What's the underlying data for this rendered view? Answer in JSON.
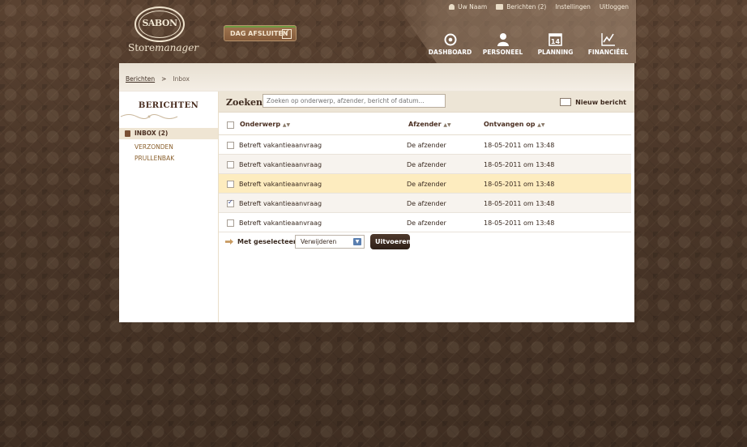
{
  "brand": {
    "logo_text": "SABON",
    "store": "Store",
    "manager": "manager"
  },
  "day_close": {
    "label": "DAG AFSLUITEN"
  },
  "topbar": {
    "user": "Uw Naam",
    "messages": "Berichten (2)",
    "settings": "Instellingen",
    "logout": "Uitloggen"
  },
  "nav": [
    {
      "label": "DASHBOARD",
      "icon": "target-icon"
    },
    {
      "label": "PERSONEEL",
      "icon": "user-icon"
    },
    {
      "label": "PLANNING",
      "icon": "calendar-icon",
      "day": "14"
    },
    {
      "label": "FINANCIËEL",
      "icon": "chart-icon"
    }
  ],
  "breadcrumb": {
    "root": "Berichten",
    "sep": ">",
    "current": "Inbox"
  },
  "sidebar": {
    "title": "BERICHTEN",
    "items": [
      {
        "label": "INBOX (2)"
      },
      {
        "label": "VERZONDEN"
      },
      {
        "label": "PRULLENBAK"
      }
    ]
  },
  "search": {
    "label": "Zoeken:",
    "placeholder": "Zoeken op onderwerp, afzender, bericht of datum..."
  },
  "new_message": {
    "label": "Nieuw bericht"
  },
  "table": {
    "headers": [
      "Onderwerp",
      "Afzender",
      "Ontvangen op"
    ],
    "sort_glyph": "▲▼",
    "rows": [
      {
        "subject": "Betreft vakantieaanvraag",
        "sender": "De afzender",
        "date": "18-05-2011 om 13:48",
        "checked": false
      },
      {
        "subject": "Betreft vakantieaanvraag",
        "sender": "De afzender",
        "date": "18-05-2011 om 13:48",
        "checked": false
      },
      {
        "subject": "Betreft vakantieaanvraag",
        "sender": "De afzender",
        "date": "18-05-2011 om 13:48",
        "checked": false
      },
      {
        "subject": "Betreft vakantieaanvraag",
        "sender": "De afzender",
        "date": "18-05-2011 om 13:48",
        "checked": true
      },
      {
        "subject": "Betreft vakantieaanvraag",
        "sender": "De afzender",
        "date": "18-05-2011 om 13:48",
        "checked": false
      }
    ]
  },
  "bulk": {
    "label": "Met geselecteerd:",
    "selected": "Verwijderen",
    "button": "Uitvoeren"
  }
}
